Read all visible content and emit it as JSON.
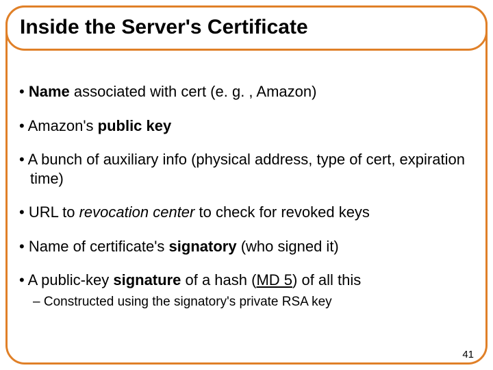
{
  "title": "Inside the Server's Certificate",
  "bullets": {
    "b1": {
      "pre": "",
      "bold1": "Name",
      "mid": " associated with cert (e. g. , Amazon)"
    },
    "b2": {
      "pre": "Amazon's ",
      "bold1": "public key"
    },
    "b3": {
      "text": "A bunch of auxiliary info (physical address, type of cert, expiration time)"
    },
    "b4": {
      "pre": "URL to ",
      "ital1": "revocation center",
      "post": " to check for revoked keys"
    },
    "b5": {
      "pre": "Name of certificate's ",
      "bold1": "signatory",
      "post": " (who signed it)"
    },
    "b6": {
      "pre": "A public-key ",
      "bold1": "signature",
      "mid": " of a hash (",
      "under1": "MD 5",
      "post": ") of all this"
    },
    "sub1": {
      "text": "Constructed using the signatory's private RSA key"
    }
  },
  "page_number": "41"
}
